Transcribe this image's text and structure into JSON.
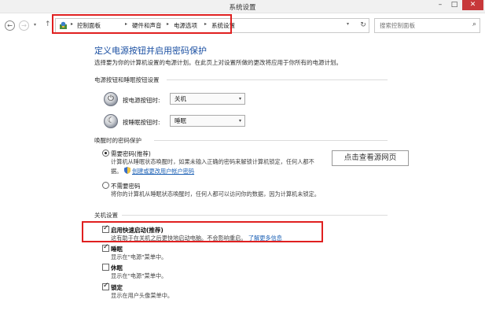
{
  "window": {
    "title": "系统设置",
    "min_glyph": "–",
    "max_glyph": "□",
    "close_glyph": "✕"
  },
  "nav": {
    "back_glyph": "←",
    "forward_glyph": "→",
    "dropdown_glyph": "▾",
    "up_glyph": "↑",
    "breadcrumbs": [
      "控制面板",
      "硬件和声音",
      "电源选项",
      "系统设置"
    ],
    "separator": "▸",
    "refresh_glyph": "↻",
    "search_placeholder": "搜索控制面板",
    "search_glyph": "⌕"
  },
  "main": {
    "heading": "定义电源按钮并启用密码保护",
    "subtext": "选择要为你的计算机设置的电源计划。在此页上对设置所做的更改将应用于你所有的电源计划。",
    "buttons_section": {
      "title": "电源按钮和睡眠按钮设置",
      "power_button": {
        "label": "按电源按钮时:",
        "value": "关机",
        "icon_glyph": "⏻"
      },
      "sleep_button": {
        "label": "按睡眠按钮时:",
        "value": "睡眠",
        "icon_glyph": "☾"
      },
      "arrow_glyph": "▾"
    },
    "wakeup_section": {
      "title": "唤醒时的密码保护",
      "require": {
        "title": "需要密码(推荐)",
        "desc1": "计算机从睡眠状态唤醒时，如果未输入正确的密码来解锁计算机锁定，任何人都不",
        "desc2_prefix": "据。",
        "link": "创建或更改用户帐户密码"
      },
      "not_require": {
        "title": "不需要密码",
        "desc": "将你的计算机从睡眠状态唤醒时，任何人都可以访问你的数据，因为计算机未锁定。"
      }
    },
    "tooltip": "点击查看源网页",
    "shutdown_section": {
      "title": "关机设置",
      "items": [
        {
          "title": "启用快速启动(推荐)",
          "desc": "这有助于在关机之后更快地启动电脑。不会影响重启。",
          "link": "了解更多信息",
          "checked": true
        },
        {
          "title": "睡眠",
          "desc": "显示在\"电源\"菜单中。",
          "checked": true
        },
        {
          "title": "休眠",
          "desc": "显示在\"电源\"菜单中。",
          "checked": false
        },
        {
          "title": "锁定",
          "desc": "显示在用户头像菜单中。",
          "checked": true
        }
      ]
    }
  },
  "colors": {
    "heading": "#1a4fa2",
    "link": "#1a5fb4",
    "highlight": "#e02020",
    "close_button": "#c7383a"
  }
}
